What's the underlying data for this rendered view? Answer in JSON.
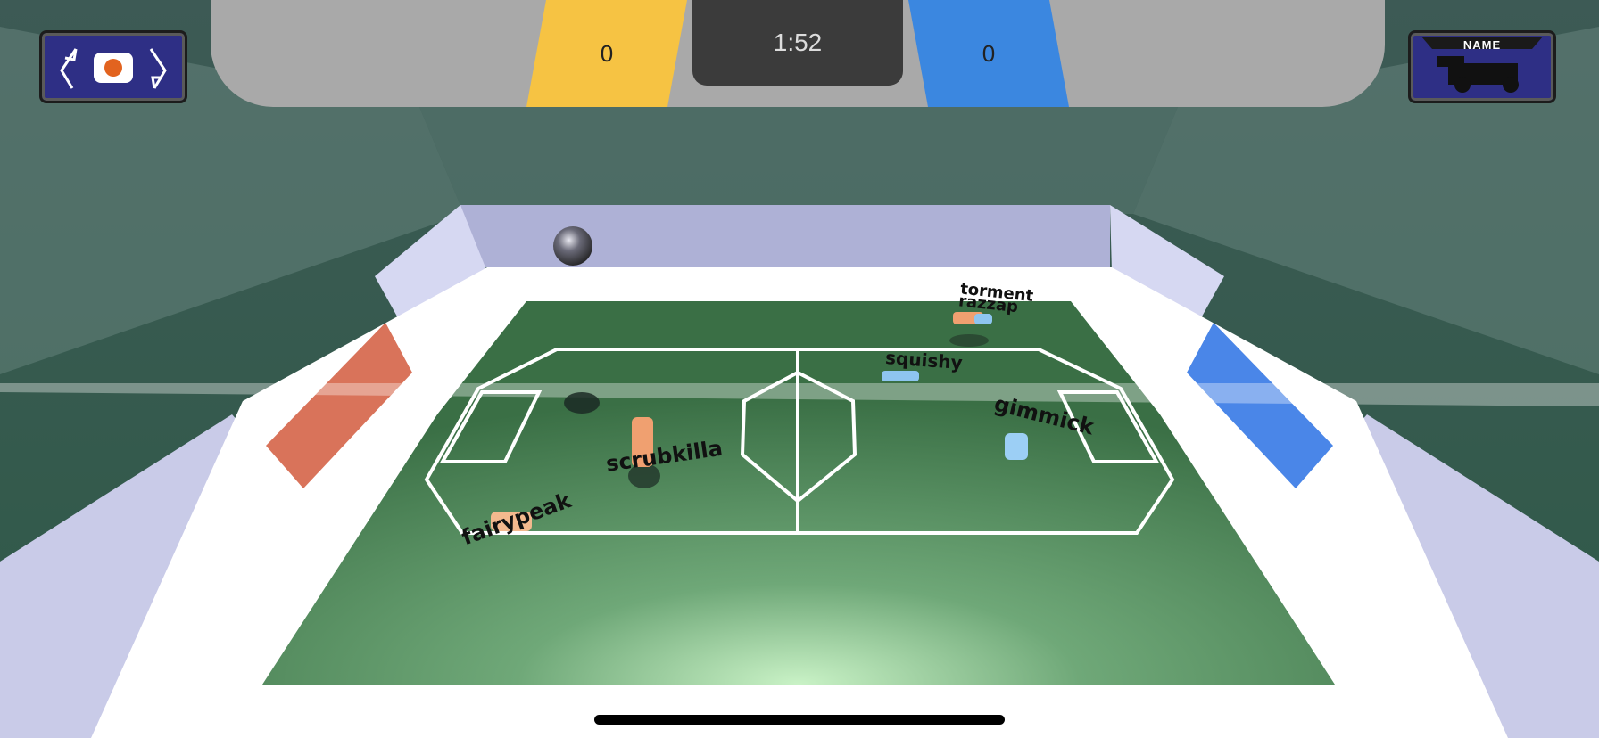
{
  "scoreboard": {
    "yellow_score": "0",
    "blue_score": "0",
    "timer": "1:52",
    "yellow_color": "#f6c343",
    "blue_color": "#3b87e0"
  },
  "controls": {
    "camera_button_icon": "camera-rotate-icon",
    "car_select_button": {
      "label": "NAME",
      "icon": "car-icon"
    }
  },
  "field": {
    "grass_color": "#3e7a4a",
    "left_goal_color": "#d9735a",
    "right_goal_color": "#4a86e8"
  },
  "players": [
    {
      "name": "torment",
      "team": "orange"
    },
    {
      "name": "razzap",
      "team": "orange"
    },
    {
      "name": "squishy",
      "team": "blue"
    },
    {
      "name": "gimmick",
      "team": "blue"
    },
    {
      "name": "scrubkilla",
      "team": "orange"
    },
    {
      "name": "fairypeak",
      "team": "orange"
    }
  ]
}
